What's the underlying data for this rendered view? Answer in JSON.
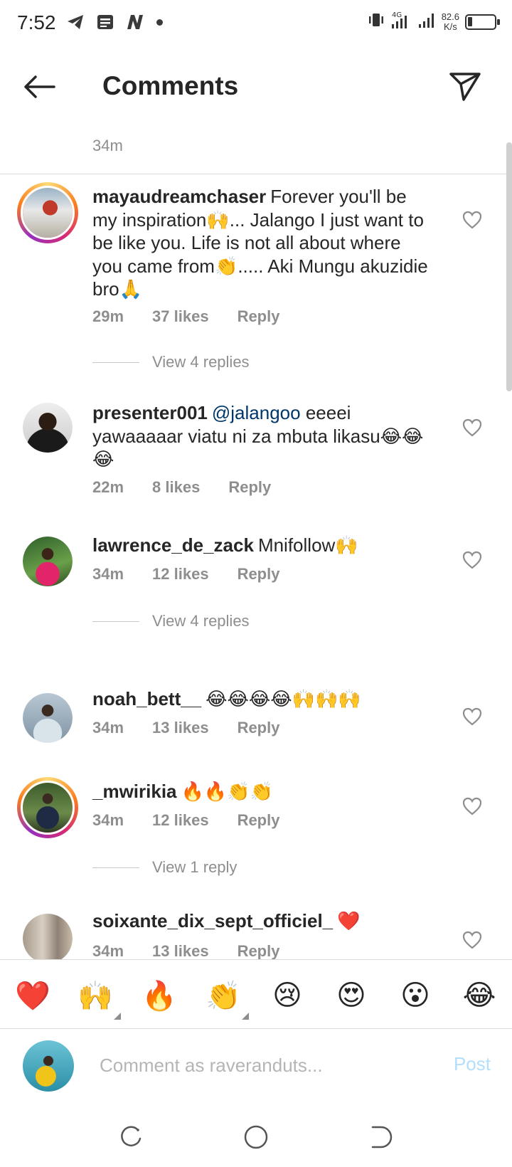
{
  "status_bar": {
    "time": "7:52",
    "net_speed_value": "82.6",
    "net_speed_unit": "K/s",
    "network": "4G"
  },
  "header": {
    "title": "Comments"
  },
  "partial_comment": {
    "time": "34m"
  },
  "comments": [
    {
      "username": "mayaudreamchaser",
      "text": "Forever you'll be my inspiration🙌... Jalango I just want to be like you. Life is not all about where you came from👏..... Aki Mungu akuzidie bro🙏",
      "time": "29m",
      "likes": "37 likes",
      "reply": "Reply",
      "view_replies": "View 4 replies"
    },
    {
      "username": "presenter001",
      "mention": "@jalangoo",
      "text": "eeeei yawaaaaar viatu ni za mbuta likasu😂😂😂",
      "time": "22m",
      "likes": "8 likes",
      "reply": "Reply"
    },
    {
      "username": "lawrence_de_zack",
      "text": "Mnifollow🙌",
      "time": "34m",
      "likes": "12 likes",
      "reply": "Reply",
      "view_replies": "View 4 replies"
    },
    {
      "username": "noah_bett__",
      "text": "😂😂😂😂🙌🙌🙌",
      "time": "34m",
      "likes": "13 likes",
      "reply": "Reply"
    },
    {
      "username": "_mwirikia",
      "text": "🔥🔥👏👏",
      "time": "34m",
      "likes": "12 likes",
      "reply": "Reply",
      "view_replies": "View 1 reply"
    },
    {
      "username": "soixante_dix_sept_officiel_",
      "text": "❤️",
      "time": "34m",
      "likes": "13 likes",
      "reply": "Reply"
    }
  ],
  "reactions": [
    "❤️",
    "🙌",
    "🔥",
    "👏",
    "😢",
    "😍",
    "😮",
    "😂"
  ],
  "input": {
    "placeholder": "Comment as raveranduts...",
    "post_label": "Post"
  },
  "colors": {
    "text": "#262626",
    "secondary": "#8e8e8e",
    "mention": "#00376b",
    "post_disabled": "#b2dffc",
    "divider": "#dbdbdb"
  }
}
